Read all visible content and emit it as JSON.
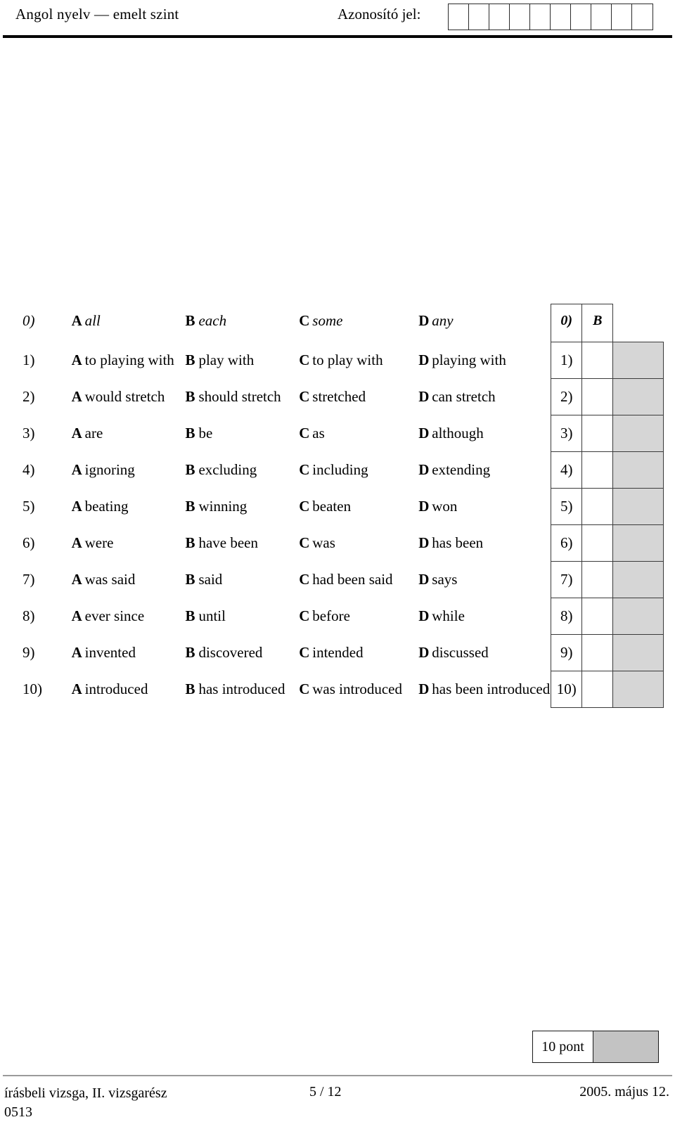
{
  "header": {
    "subject": "Angol nyelv — emelt szint",
    "id_label": "Azonosító jel:",
    "id_box_count": 10
  },
  "quiz": {
    "example": {
      "number": "0)",
      "options": [
        {
          "letter": "A",
          "text": "all"
        },
        {
          "letter": "B",
          "text": "each"
        },
        {
          "letter": "C",
          "text": "some"
        },
        {
          "letter": "D",
          "text": "any"
        }
      ],
      "grid_number": "0)",
      "grid_answer": "B"
    },
    "rows": [
      {
        "number": "1)",
        "options": [
          {
            "letter": "A",
            "text": "to playing with"
          },
          {
            "letter": "B",
            "text": "play with"
          },
          {
            "letter": "C",
            "text": "to play with"
          },
          {
            "letter": "D",
            "text": "playing with"
          }
        ],
        "grid_number": "1)",
        "grid_answer": ""
      },
      {
        "number": "2)",
        "options": [
          {
            "letter": "A",
            "text": "would stretch"
          },
          {
            "letter": "B",
            "text": "should stretch"
          },
          {
            "letter": "C",
            "text": "stretched"
          },
          {
            "letter": "D",
            "text": "can stretch"
          }
        ],
        "grid_number": "2)",
        "grid_answer": ""
      },
      {
        "number": "3)",
        "options": [
          {
            "letter": "A",
            "text": "are"
          },
          {
            "letter": "B",
            "text": "be"
          },
          {
            "letter": "C",
            "text": "as"
          },
          {
            "letter": "D",
            "text": "although"
          }
        ],
        "grid_number": "3)",
        "grid_answer": ""
      },
      {
        "number": "4)",
        "options": [
          {
            "letter": "A",
            "text": "ignoring"
          },
          {
            "letter": "B",
            "text": "excluding"
          },
          {
            "letter": "C",
            "text": "including"
          },
          {
            "letter": "D",
            "text": "extending"
          }
        ],
        "grid_number": "4)",
        "grid_answer": ""
      },
      {
        "number": "5)",
        "options": [
          {
            "letter": "A",
            "text": "beating"
          },
          {
            "letter": "B",
            "text": "winning"
          },
          {
            "letter": "C",
            "text": "beaten"
          },
          {
            "letter": "D",
            "text": "won"
          }
        ],
        "grid_number": "5)",
        "grid_answer": ""
      },
      {
        "number": "6)",
        "options": [
          {
            "letter": "A",
            "text": "were"
          },
          {
            "letter": "B",
            "text": "have been"
          },
          {
            "letter": "C",
            "text": "was"
          },
          {
            "letter": "D",
            "text": "has been"
          }
        ],
        "grid_number": "6)",
        "grid_answer": ""
      },
      {
        "number": "7)",
        "options": [
          {
            "letter": "A",
            "text": "was said"
          },
          {
            "letter": "B",
            "text": "said"
          },
          {
            "letter": "C",
            "text": "had been said"
          },
          {
            "letter": "D",
            "text": "says"
          }
        ],
        "grid_number": "7)",
        "grid_answer": ""
      },
      {
        "number": "8)",
        "options": [
          {
            "letter": "A",
            "text": "ever since"
          },
          {
            "letter": "B",
            "text": "until"
          },
          {
            "letter": "C",
            "text": "before"
          },
          {
            "letter": "D",
            "text": "while"
          }
        ],
        "grid_number": "8)",
        "grid_answer": ""
      },
      {
        "number": "9)",
        "options": [
          {
            "letter": "A",
            "text": "invented"
          },
          {
            "letter": "B",
            "text": "discovered"
          },
          {
            "letter": "C",
            "text": "intended"
          },
          {
            "letter": "D",
            "text": "discussed"
          }
        ],
        "grid_number": "9)",
        "grid_answer": ""
      },
      {
        "number": "10)",
        "options": [
          {
            "letter": "A",
            "text": "introduced"
          },
          {
            "letter": "B",
            "text": "has introduced"
          },
          {
            "letter": "C",
            "text": "was introduced"
          },
          {
            "letter": "D",
            "text": "has been introduced"
          }
        ],
        "grid_number": "10)",
        "grid_answer": ""
      }
    ]
  },
  "points": {
    "label": "10 pont"
  },
  "footer": {
    "left_line1": "írásbeli vizsga, II. vizsgarész",
    "left_line2": "0513",
    "page": "5 / 12",
    "date": "2005. május 12."
  }
}
